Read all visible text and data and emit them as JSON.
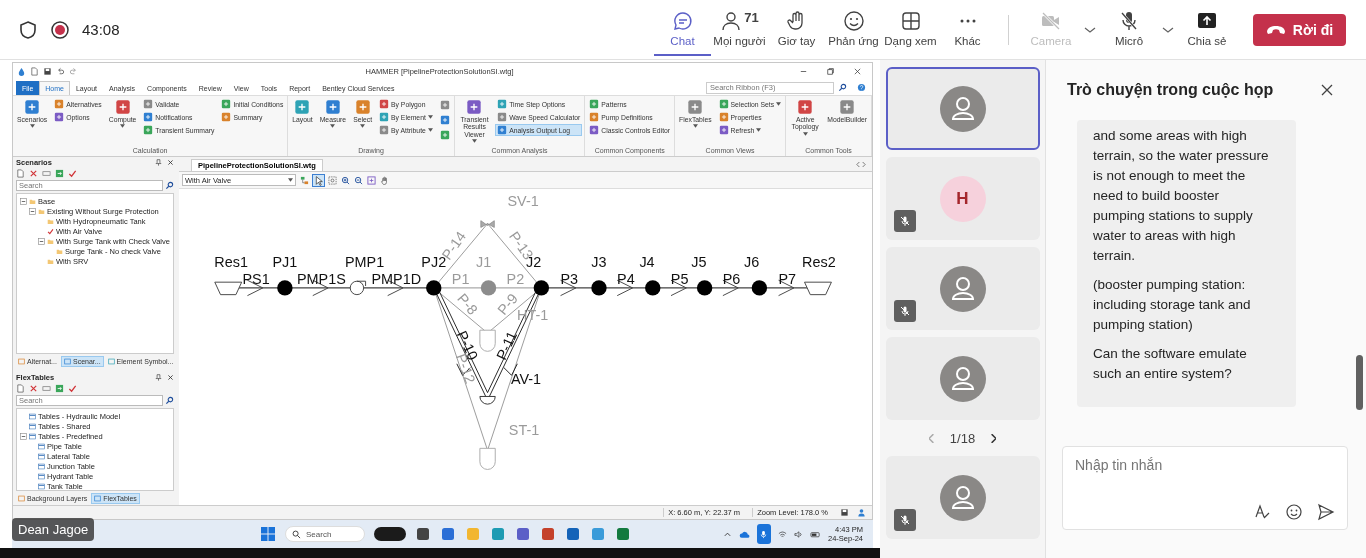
{
  "meeting": {
    "recording": true,
    "timer": "43:08",
    "actions": [
      {
        "kind": "chat",
        "label": "Chat",
        "selected": true
      },
      {
        "kind": "people",
        "label": "Mọi người",
        "count": "71",
        "selected": false
      },
      {
        "kind": "hand",
        "label": "Giơ tay",
        "selected": false
      },
      {
        "kind": "react",
        "label": "Phản ứng",
        "selected": false
      },
      {
        "kind": "view",
        "label": "Dạng xem",
        "selected": false
      },
      {
        "kind": "more",
        "label": "Khác",
        "selected": false
      }
    ],
    "devices": [
      {
        "kind": "camera",
        "label": "Camera",
        "disabled": true,
        "dropdown": true
      },
      {
        "kind": "mic",
        "label": "Micrô",
        "disabled": false,
        "dropdown": true
      },
      {
        "kind": "share",
        "label": "Chia sẻ",
        "disabled": false
      }
    ],
    "leave_button": "Rời đi"
  },
  "shared_screen": {
    "presenter": "Dean Jagoe",
    "app": {
      "title": "HAMMER [PipelineProtectionSolutionSI.wtg]",
      "menu_tabs": [
        {
          "label": "File",
          "kind": "file",
          "selected": false
        },
        {
          "label": "Home",
          "kind": "tab",
          "selected": true
        },
        {
          "label": "Layout",
          "kind": "tab",
          "selected": false
        },
        {
          "label": "Analysis",
          "kind": "tab",
          "selected": false
        },
        {
          "label": "Components",
          "kind": "tab",
          "selected": false
        },
        {
          "label": "Review",
          "kind": "tab",
          "selected": false
        },
        {
          "label": "View",
          "kind": "tab",
          "selected": false
        },
        {
          "label": "Tools",
          "kind": "tab",
          "selected": false
        },
        {
          "label": "Report",
          "kind": "tab",
          "selected": false
        },
        {
          "label": "Bentley Cloud Services",
          "kind": "tab",
          "selected": false
        }
      ],
      "ribbon_search": {
        "placeholder": "Search Ribbon (F3)"
      },
      "ribbon_groups": [
        {
          "title": "Calculation",
          "columns": [
            [
              {
                "label": "Scenarios",
                "kind": "large",
                "dropdown": true
              }
            ],
            [
              {
                "label": "Alternatives",
                "kind": "small"
              },
              {
                "label": "Options",
                "kind": "small"
              }
            ],
            [
              {
                "label": "Compute",
                "kind": "large",
                "dropdown": true
              }
            ],
            [
              {
                "label": "Validate",
                "kind": "small"
              },
              {
                "label": "Notifications",
                "kind": "small"
              },
              {
                "label": "Transient Summary",
                "kind": "small"
              }
            ],
            [
              {
                "label": "Initial Conditions",
                "kind": "small"
              },
              {
                "label": "Summary",
                "kind": "small"
              }
            ]
          ]
        },
        {
          "title": "Drawing",
          "columns": [
            [
              {
                "label": "Layout",
                "kind": "large"
              }
            ],
            [
              {
                "label": "Measure",
                "kind": "large",
                "dropdown": true
              }
            ],
            [
              {
                "label": "Select",
                "kind": "large",
                "dropdown": true
              }
            ],
            [
              {
                "label": "By Polygon",
                "kind": "small"
              },
              {
                "label": "By Element",
                "kind": "small",
                "dropdown": true
              },
              {
                "label": "By Attribute",
                "kind": "small",
                "dropdown": true
              }
            ],
            [
              {
                "kind": "icon"
              },
              {
                "kind": "icon"
              },
              {
                "kind": "icon"
              }
            ]
          ]
        },
        {
          "title": "Common Analysis",
          "columns": [
            [
              {
                "label": "Transient Results Viewer",
                "kind": "large",
                "dropdown": true
              }
            ],
            [
              {
                "label": "Time Step Options",
                "kind": "small",
                "highlighted": false
              },
              {
                "label": "Wave Speed Calculator",
                "kind": "small",
                "highlighted": false
              },
              {
                "label": "Analysis Output Log",
                "kind": "small",
                "highlighted": true
              }
            ]
          ]
        },
        {
          "title": "Common Components",
          "columns": [
            [
              {
                "label": "Patterns",
                "kind": "small"
              },
              {
                "label": "Pump Definitions",
                "kind": "small"
              },
              {
                "label": "Classic Controls Editor",
                "kind": "small"
              }
            ]
          ]
        },
        {
          "title": "Common Views",
          "columns": [
            [
              {
                "label": "FlexTables",
                "kind": "large",
                "dropdown": true
              }
            ],
            [
              {
                "label": "Selection Sets",
                "kind": "small",
                "dropdown": true
              },
              {
                "label": "Properties",
                "kind": "small"
              },
              {
                "label": "Refresh",
                "kind": "small",
                "dropdown": true
              }
            ]
          ]
        },
        {
          "title": "Common Tools",
          "columns": [
            [
              {
                "label": "Active Topology",
                "kind": "large",
                "dropdown": true
              }
            ],
            [
              {
                "label": "ModelBuilder",
                "kind": "large"
              }
            ]
          ]
        }
      ],
      "scenarios_panel": {
        "title": "Scenarios",
        "search": {
          "placeholder": "Search"
        },
        "tree": [
          {
            "label": "Base",
            "current": false,
            "expanded": true,
            "children": [
              {
                "label": "Existing Without Surge Protection",
                "current": false,
                "expanded": true,
                "children": [
                  {
                    "label": "With Hydropneumatic Tank",
                    "current": false
                  },
                  {
                    "label": "With Air Valve",
                    "current": true
                  },
                  {
                    "label": "With Surge Tank with Check Valve",
                    "current": false,
                    "expanded": true,
                    "children": [
                      {
                        "label": "Surge Tank - No check Valve",
                        "current": false
                      }
                    ]
                  },
                  {
                    "label": "With SRV",
                    "current": false
                  }
                ]
              }
            ]
          }
        ],
        "tabs": [
          {
            "label": "Alternat...",
            "selected": false
          },
          {
            "label": "Scenar...",
            "selected": true
          },
          {
            "label": "Element Symbol...",
            "selected": false
          }
        ]
      },
      "flextables_panel": {
        "title": "FlexTables",
        "search": {
          "placeholder": "Search"
        },
        "tree": [
          {
            "label": "Tables - Hydraulic Model",
            "current": false
          },
          {
            "label": "Tables - Shared",
            "current": false
          },
          {
            "label": "Tables - Predefined",
            "current": false,
            "expanded": true,
            "children": [
              {
                "label": "Pipe Table",
                "current": false
              },
              {
                "label": "Lateral Table",
                "current": false
              },
              {
                "label": "Junction Table",
                "current": false
              },
              {
                "label": "Hydrant Table",
                "current": false
              },
              {
                "label": "Tank Table",
                "current": false
              }
            ]
          }
        ],
        "tabs": [
          {
            "label": "Background Layers",
            "selected": false
          },
          {
            "label": "FlexTables",
            "selected": true
          }
        ]
      },
      "document": {
        "tab": "PipelineProtectionSolutionSI.wtg",
        "scenario_dropdown": "With Air Valve",
        "diagram_labels": [
          {
            "text": "SV-1",
            "active": false
          },
          {
            "text": "Res1",
            "active": true
          },
          {
            "text": "PJ1",
            "active": true
          },
          {
            "text": "PMP1",
            "active": true
          },
          {
            "text": "PJ2",
            "active": true
          },
          {
            "text": "J1",
            "active": false
          },
          {
            "text": "J2",
            "active": true
          },
          {
            "text": "J3",
            "active": true
          },
          {
            "text": "J4",
            "active": true
          },
          {
            "text": "J5",
            "active": true
          },
          {
            "text": "J6",
            "active": true
          },
          {
            "text": "Res2",
            "active": true
          },
          {
            "text": "PS1",
            "active": true
          },
          {
            "text": "PMP1S",
            "active": true
          },
          {
            "text": "PMP1D",
            "active": true
          },
          {
            "text": "P1",
            "active": false
          },
          {
            "text": "P2",
            "active": false
          },
          {
            "text": "P3",
            "active": true
          },
          {
            "text": "P4",
            "active": true
          },
          {
            "text": "P5",
            "active": true
          },
          {
            "text": "P6",
            "active": true
          },
          {
            "text": "P7",
            "active": true
          },
          {
            "text": "P-14",
            "active": false
          },
          {
            "text": "P-13",
            "active": false
          },
          {
            "text": "P-8",
            "active": false
          },
          {
            "text": "P-9",
            "active": false
          },
          {
            "text": "HT-1",
            "active": false
          },
          {
            "text": "P-10",
            "active": true
          },
          {
            "text": "P-11",
            "active": true
          },
          {
            "text": "P-12",
            "active": false
          },
          {
            "text": "AV-1",
            "active": true
          },
          {
            "text": "ST-1",
            "active": false
          }
        ]
      },
      "status_bar": {
        "coordinates": "X: 6.60 m, Y: 22.37 m",
        "zoom": "Zoom Level: 178.0 %"
      }
    },
    "taskbar": {
      "search": {
        "placeholder": "Search"
      },
      "time": "4:43 PM",
      "date": "24-Sep-24"
    }
  },
  "participants": {
    "tiles": [
      {
        "kind": "avatar",
        "muted": false,
        "selected": true
      },
      {
        "kind": "initial",
        "initial": "H",
        "muted": true,
        "selected": false
      },
      {
        "kind": "avatar",
        "muted": true,
        "selected": false
      },
      {
        "kind": "avatar",
        "muted": false,
        "selected": false
      }
    ],
    "pagination": "1/18",
    "next_tiles": [
      {
        "kind": "avatar",
        "muted": true,
        "selected": false
      }
    ]
  },
  "chat": {
    "title": "Trò chuyện trong cuộc họp",
    "message": {
      "paragraphs": [
        "and some areas with high terrain, so the water pressure is not enough to meet the need to build booster pumping stations to supply water to areas with high terrain.",
        "(booster pumping station: including storage tank and pumping station)",
        "Can the software emulate such an entire system?"
      ]
    },
    "composer": {
      "placeholder": "Nhập tin nhắn"
    }
  }
}
